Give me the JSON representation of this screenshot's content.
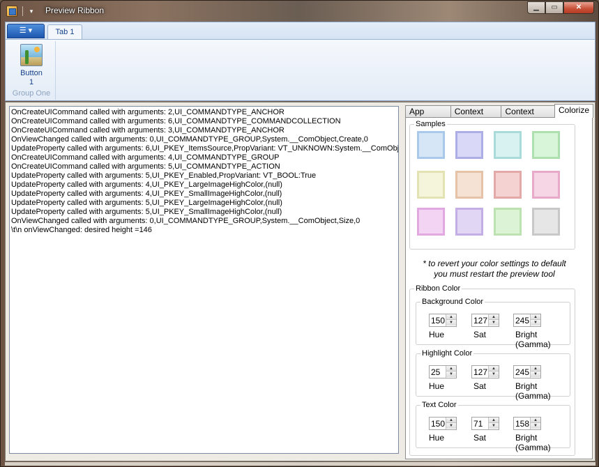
{
  "window": {
    "title": "Preview Ribbon",
    "caption_buttons": {
      "minimize": "▁",
      "maximize": "▭",
      "close": "✕"
    }
  },
  "qat": {
    "dropdown_glyph": "▾"
  },
  "ribbon": {
    "app_menu_glyph": "☰ ▾",
    "tabs": [
      {
        "label": "Tab 1"
      }
    ],
    "groups": [
      {
        "label": "Group One",
        "buttons": [
          {
            "label": "Button\n1",
            "icon": "cactus-image-icon"
          }
        ]
      }
    ]
  },
  "log": {
    "lines": [
      "OnCreateUICommand called with arguments: 2,UI_COMMANDTYPE_ANCHOR",
      "OnCreateUICommand called with arguments: 6,UI_COMMANDTYPE_COMMANDCOLLECTION",
      "OnCreateUICommand called with arguments: 3,UI_COMMANDTYPE_ANCHOR",
      "OnViewChanged called with arguments: 0,UI_COMMANDTYPE_GROUP,System.__ComObject,Create,0",
      "UpdateProperty called with arguments: 6,UI_PKEY_ItemsSource,PropVariant: VT_UNKNOWN:System.__ComObject",
      "OnCreateUICommand called with arguments: 4,UI_COMMANDTYPE_GROUP",
      "OnCreateUICommand called with arguments: 5,UI_COMMANDTYPE_ACTION",
      "UpdateProperty called with arguments: 5,UI_PKEY_Enabled,PropVariant: VT_BOOL:True",
      "UpdateProperty called with arguments: 4,UI_PKEY_LargeImageHighColor,(null)",
      "UpdateProperty called with arguments: 4,UI_PKEY_SmallImageHighColor,(null)",
      "UpdateProperty called with arguments: 5,UI_PKEY_LargeImageHighColor,(null)",
      "UpdateProperty called with arguments: 5,UI_PKEY_SmallImageHighColor,(null)",
      "OnViewChanged called with arguments: 0,UI_COMMANDTYPE_GROUP,System.__ComObject,Size,0",
      "\\t\\n onViewChanged: desired height =146"
    ]
  },
  "panel": {
    "tabs": [
      {
        "label": "App Modes"
      },
      {
        "label": "Context Tabs"
      },
      {
        "label": "Context Maps"
      },
      {
        "label": "Colorize",
        "active": true
      }
    ],
    "samples": {
      "title": "Samples",
      "swatches": [
        {
          "fill": "#d6e6f7",
          "border": "#a9c9ea"
        },
        {
          "fill": "#d9d9f7",
          "border": "#aeaee6"
        },
        {
          "fill": "#d8f1f1",
          "border": "#aadbdb"
        },
        {
          "fill": "#d9f5d9",
          "border": "#aedfae"
        },
        {
          "fill": "#f5f5dc",
          "border": "#e2e2b3"
        },
        {
          "fill": "#f5e2d4",
          "border": "#e6c3a8"
        },
        {
          "fill": "#f4d2d2",
          "border": "#e3a8a8"
        },
        {
          "fill": "#f6d6e5",
          "border": "#e7aac8"
        },
        {
          "fill": "#f3d5f3",
          "border": "#e1a8e1"
        },
        {
          "fill": "#e2d6f5",
          "border": "#c4aee6"
        },
        {
          "fill": "#dcf3d6",
          "border": "#bde2b2"
        },
        {
          "fill": "#e6e6e6",
          "border": "#c8c8c8"
        }
      ]
    },
    "note_line1": "* to revert your color settings to default",
    "note_line2": "you must restart the preview tool",
    "ribbon_color": {
      "title": "Ribbon Color",
      "background": {
        "title": "Background Color",
        "hue": "150",
        "sat": "127",
        "bright": "245"
      },
      "highlight": {
        "title": "Highlight Color",
        "hue": "25",
        "sat": "127",
        "bright": "245"
      },
      "text": {
        "title": "Text Color",
        "hue": "150",
        "sat": "71",
        "bright": "158"
      },
      "labels": {
        "hue": "Hue",
        "sat": "Sat",
        "bright": "Bright (Gamma)"
      }
    }
  }
}
